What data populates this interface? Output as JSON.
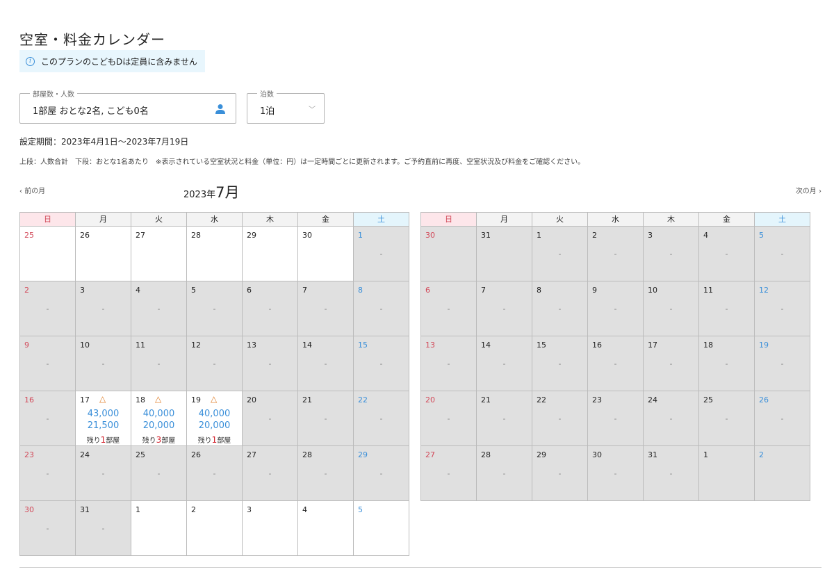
{
  "title": "空室・料金カレンダー",
  "notice": "このプランのこどもDは定員に含みません",
  "rooms": {
    "legend": "部屋数・人数",
    "value": "1部屋 おとな2名, こども0名"
  },
  "nights": {
    "legend": "泊数",
    "value": "1泊"
  },
  "period": "設定期間：2023年4月1日〜2023年7月19日",
  "note": "上段：人数合計　下段：おとな1名あたり　※表示されている空室状況と料金（単位：円）は一定時間ごとに更新されます。ご予約直前に再度、空室状況及び料金をご確認ください。",
  "nav": {
    "prev": "前の月",
    "next": "次の月"
  },
  "month": {
    "year": "2023年",
    "month": "7月"
  },
  "weekdays": [
    "日",
    "月",
    "火",
    "水",
    "木",
    "金",
    "土"
  ],
  "dash": "-",
  "calendars": [
    {
      "weeks": [
        [
          {
            "d": "25",
            "w": true
          },
          {
            "d": "26",
            "w": true
          },
          {
            "d": "27",
            "w": true
          },
          {
            "d": "28",
            "w": true
          },
          {
            "d": "29",
            "w": true
          },
          {
            "d": "30",
            "w": true
          },
          {
            "d": "1",
            "dash": true
          }
        ],
        [
          {
            "d": "2",
            "dash": true
          },
          {
            "d": "3",
            "dash": true
          },
          {
            "d": "4",
            "dash": true
          },
          {
            "d": "5",
            "dash": true
          },
          {
            "d": "6",
            "dash": true
          },
          {
            "d": "7",
            "dash": true
          },
          {
            "d": "8",
            "dash": true
          }
        ],
        [
          {
            "d": "9",
            "dash": true
          },
          {
            "d": "10",
            "dash": true
          },
          {
            "d": "11",
            "dash": true
          },
          {
            "d": "12",
            "dash": true
          },
          {
            "d": "13",
            "dash": true
          },
          {
            "d": "14",
            "dash": true
          },
          {
            "d": "15",
            "dash": true
          }
        ],
        [
          {
            "d": "16",
            "dash": true
          },
          {
            "d": "17",
            "w": true,
            "avail": {
              "mark": "△",
              "p1": "43,000",
              "p2": "21,500",
              "pre": "残り",
              "n": "1",
              "post": "部屋"
            }
          },
          {
            "d": "18",
            "w": true,
            "avail": {
              "mark": "△",
              "p1": "40,000",
              "p2": "20,000",
              "pre": "残り",
              "n": "3",
              "post": "部屋"
            }
          },
          {
            "d": "19",
            "w": true,
            "avail": {
              "mark": "△",
              "p1": "40,000",
              "p2": "20,000",
              "pre": "残り",
              "n": "1",
              "post": "部屋"
            }
          },
          {
            "d": "20",
            "dash": true
          },
          {
            "d": "21",
            "dash": true
          },
          {
            "d": "22",
            "dash": true
          }
        ],
        [
          {
            "d": "23",
            "dash": true
          },
          {
            "d": "24",
            "dash": true
          },
          {
            "d": "25",
            "dash": true
          },
          {
            "d": "26",
            "dash": true
          },
          {
            "d": "27",
            "dash": true
          },
          {
            "d": "28",
            "dash": true
          },
          {
            "d": "29",
            "dash": true
          }
        ],
        [
          {
            "d": "30",
            "dash": true
          },
          {
            "d": "31",
            "dash": true
          },
          {
            "d": "1",
            "w": true
          },
          {
            "d": "2",
            "w": true
          },
          {
            "d": "3",
            "w": true
          },
          {
            "d": "4",
            "w": true
          },
          {
            "d": "5",
            "w": true
          }
        ]
      ]
    },
    {
      "weeks": [
        [
          {
            "d": "30"
          },
          {
            "d": "31"
          },
          {
            "d": "1",
            "dash": true
          },
          {
            "d": "2",
            "dash": true
          },
          {
            "d": "3",
            "dash": true
          },
          {
            "d": "4",
            "dash": true
          },
          {
            "d": "5",
            "dash": true
          }
        ],
        [
          {
            "d": "6",
            "dash": true
          },
          {
            "d": "7",
            "dash": true
          },
          {
            "d": "8",
            "dash": true
          },
          {
            "d": "9",
            "dash": true
          },
          {
            "d": "10",
            "dash": true
          },
          {
            "d": "11",
            "dash": true
          },
          {
            "d": "12",
            "dash": true
          }
        ],
        [
          {
            "d": "13",
            "dash": true
          },
          {
            "d": "14",
            "dash": true
          },
          {
            "d": "15",
            "dash": true
          },
          {
            "d": "16",
            "dash": true
          },
          {
            "d": "17",
            "dash": true
          },
          {
            "d": "18",
            "dash": true
          },
          {
            "d": "19",
            "dash": true
          }
        ],
        [
          {
            "d": "20",
            "dash": true
          },
          {
            "d": "21",
            "dash": true
          },
          {
            "d": "22",
            "dash": true
          },
          {
            "d": "23",
            "dash": true
          },
          {
            "d": "24",
            "dash": true
          },
          {
            "d": "25",
            "dash": true
          },
          {
            "d": "26",
            "dash": true
          }
        ],
        [
          {
            "d": "27",
            "dash": true
          },
          {
            "d": "28",
            "dash": true
          },
          {
            "d": "29",
            "dash": true
          },
          {
            "d": "30",
            "dash": true
          },
          {
            "d": "31",
            "dash": true
          },
          {
            "d": "1"
          },
          {
            "d": "2"
          }
        ]
      ]
    }
  ]
}
